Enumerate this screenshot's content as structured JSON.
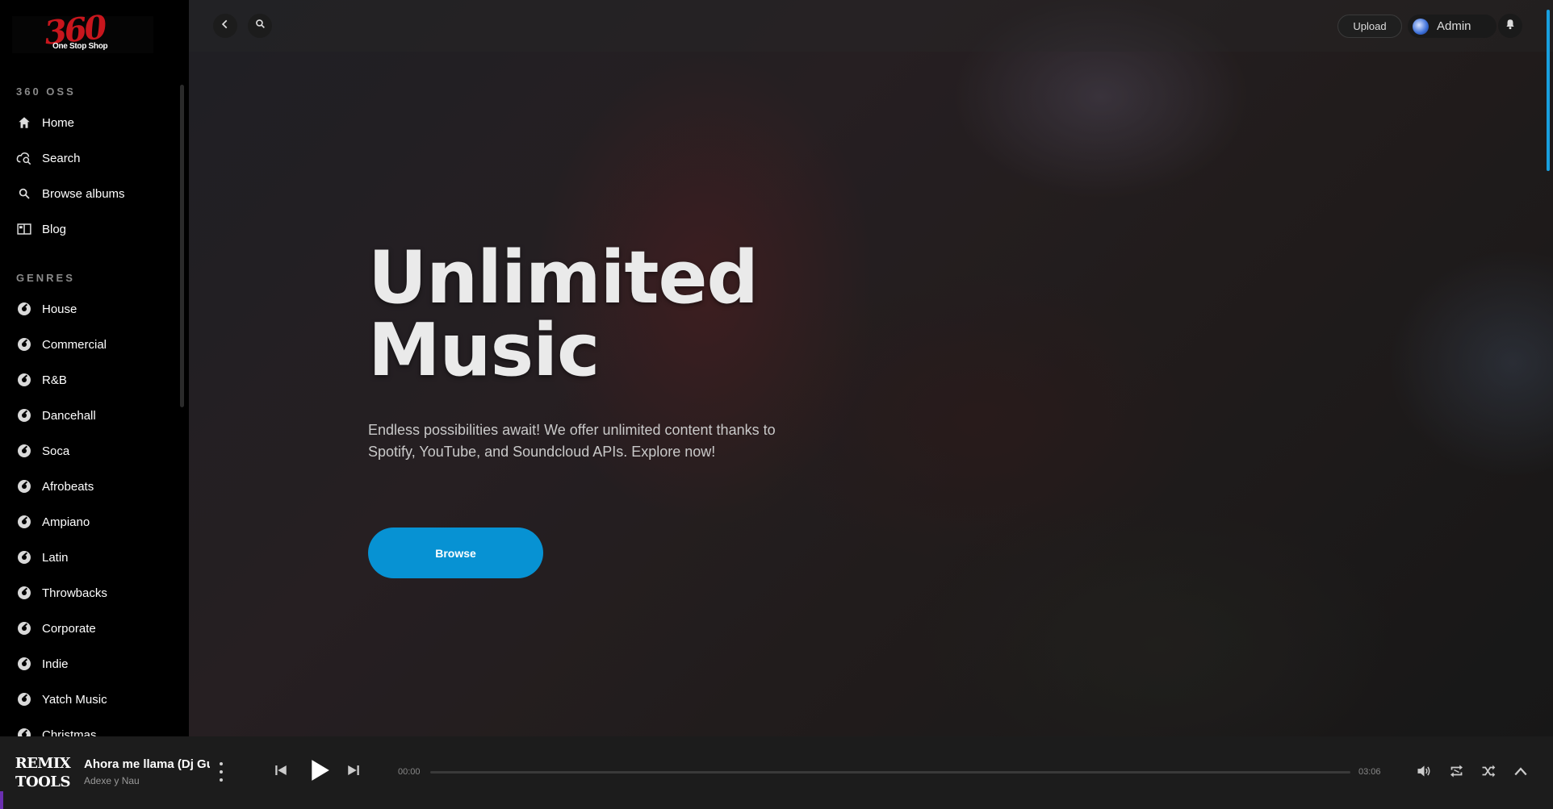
{
  "logo": {
    "mark": "360",
    "tagline": "One Stop Shop"
  },
  "sidebar": {
    "section_main": "360 OSS",
    "main_items": [
      {
        "label": "Home",
        "icon": "home-icon"
      },
      {
        "label": "Search",
        "icon": "cloud-search-icon"
      },
      {
        "label": "Browse albums",
        "icon": "search-icon"
      },
      {
        "label": "Blog",
        "icon": "blog-icon"
      }
    ],
    "section_genres": "GENRES",
    "genres": [
      "House",
      "Commercial",
      "R&B",
      "Dancehall",
      "Soca",
      "Afrobeats",
      "Ampiano",
      "Latin",
      "Throwbacks",
      "Corporate",
      "Indie",
      "Yatch Music",
      "Christmas"
    ]
  },
  "topbar": {
    "upload_label": "Upload",
    "user_name": "Admin"
  },
  "hero": {
    "title_line1": "Unlimited",
    "title_line2": "Music",
    "subtitle": "Endless possibilities await! We offer unlimited content thanks to Spotify, YouTube, and Soundcloud APIs. Explore now!",
    "button_label": "Browse"
  },
  "player": {
    "cover_line1": "REMIX",
    "cover_line2": "TOOLS",
    "track_title": "Ahora me llama (Dj Gu",
    "track_artist": "Adexe y Nau",
    "time_current": "00:00",
    "time_total": "03:06",
    "progress": 0
  },
  "colors": {
    "accent": "#0792d3",
    "brand_red": "#c8161d",
    "sidebar_bg": "#000000",
    "player_bg": "#1c1c1c"
  }
}
